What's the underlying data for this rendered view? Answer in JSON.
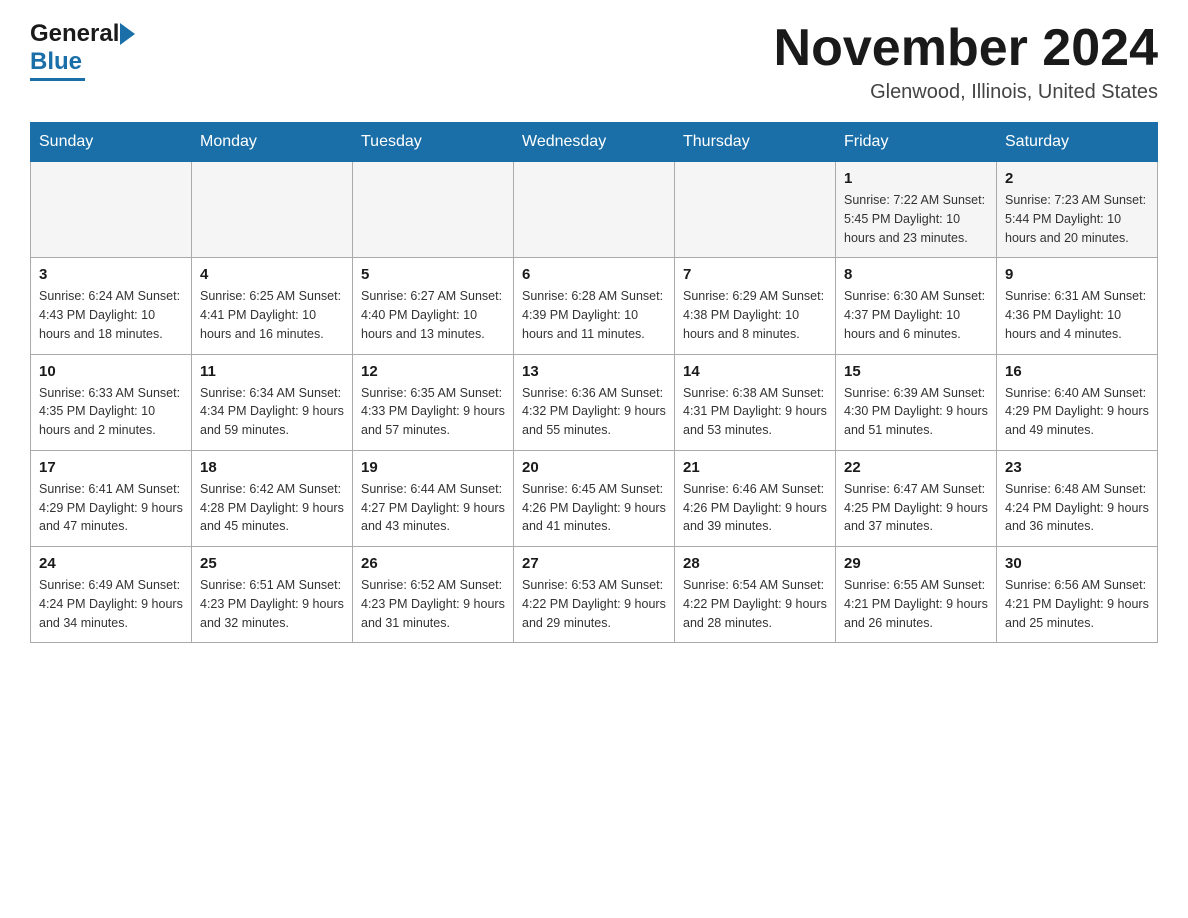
{
  "logo": {
    "general": "General",
    "blue": "Blue"
  },
  "title": "November 2024",
  "location": "Glenwood, Illinois, United States",
  "weekdays": [
    "Sunday",
    "Monday",
    "Tuesday",
    "Wednesday",
    "Thursday",
    "Friday",
    "Saturday"
  ],
  "weeks": [
    [
      {
        "day": "",
        "info": ""
      },
      {
        "day": "",
        "info": ""
      },
      {
        "day": "",
        "info": ""
      },
      {
        "day": "",
        "info": ""
      },
      {
        "day": "",
        "info": ""
      },
      {
        "day": "1",
        "info": "Sunrise: 7:22 AM\nSunset: 5:45 PM\nDaylight: 10 hours and 23 minutes."
      },
      {
        "day": "2",
        "info": "Sunrise: 7:23 AM\nSunset: 5:44 PM\nDaylight: 10 hours and 20 minutes."
      }
    ],
    [
      {
        "day": "3",
        "info": "Sunrise: 6:24 AM\nSunset: 4:43 PM\nDaylight: 10 hours and 18 minutes."
      },
      {
        "day": "4",
        "info": "Sunrise: 6:25 AM\nSunset: 4:41 PM\nDaylight: 10 hours and 16 minutes."
      },
      {
        "day": "5",
        "info": "Sunrise: 6:27 AM\nSunset: 4:40 PM\nDaylight: 10 hours and 13 minutes."
      },
      {
        "day": "6",
        "info": "Sunrise: 6:28 AM\nSunset: 4:39 PM\nDaylight: 10 hours and 11 minutes."
      },
      {
        "day": "7",
        "info": "Sunrise: 6:29 AM\nSunset: 4:38 PM\nDaylight: 10 hours and 8 minutes."
      },
      {
        "day": "8",
        "info": "Sunrise: 6:30 AM\nSunset: 4:37 PM\nDaylight: 10 hours and 6 minutes."
      },
      {
        "day": "9",
        "info": "Sunrise: 6:31 AM\nSunset: 4:36 PM\nDaylight: 10 hours and 4 minutes."
      }
    ],
    [
      {
        "day": "10",
        "info": "Sunrise: 6:33 AM\nSunset: 4:35 PM\nDaylight: 10 hours and 2 minutes."
      },
      {
        "day": "11",
        "info": "Sunrise: 6:34 AM\nSunset: 4:34 PM\nDaylight: 9 hours and 59 minutes."
      },
      {
        "day": "12",
        "info": "Sunrise: 6:35 AM\nSunset: 4:33 PM\nDaylight: 9 hours and 57 minutes."
      },
      {
        "day": "13",
        "info": "Sunrise: 6:36 AM\nSunset: 4:32 PM\nDaylight: 9 hours and 55 minutes."
      },
      {
        "day": "14",
        "info": "Sunrise: 6:38 AM\nSunset: 4:31 PM\nDaylight: 9 hours and 53 minutes."
      },
      {
        "day": "15",
        "info": "Sunrise: 6:39 AM\nSunset: 4:30 PM\nDaylight: 9 hours and 51 minutes."
      },
      {
        "day": "16",
        "info": "Sunrise: 6:40 AM\nSunset: 4:29 PM\nDaylight: 9 hours and 49 minutes."
      }
    ],
    [
      {
        "day": "17",
        "info": "Sunrise: 6:41 AM\nSunset: 4:29 PM\nDaylight: 9 hours and 47 minutes."
      },
      {
        "day": "18",
        "info": "Sunrise: 6:42 AM\nSunset: 4:28 PM\nDaylight: 9 hours and 45 minutes."
      },
      {
        "day": "19",
        "info": "Sunrise: 6:44 AM\nSunset: 4:27 PM\nDaylight: 9 hours and 43 minutes."
      },
      {
        "day": "20",
        "info": "Sunrise: 6:45 AM\nSunset: 4:26 PM\nDaylight: 9 hours and 41 minutes."
      },
      {
        "day": "21",
        "info": "Sunrise: 6:46 AM\nSunset: 4:26 PM\nDaylight: 9 hours and 39 minutes."
      },
      {
        "day": "22",
        "info": "Sunrise: 6:47 AM\nSunset: 4:25 PM\nDaylight: 9 hours and 37 minutes."
      },
      {
        "day": "23",
        "info": "Sunrise: 6:48 AM\nSunset: 4:24 PM\nDaylight: 9 hours and 36 minutes."
      }
    ],
    [
      {
        "day": "24",
        "info": "Sunrise: 6:49 AM\nSunset: 4:24 PM\nDaylight: 9 hours and 34 minutes."
      },
      {
        "day": "25",
        "info": "Sunrise: 6:51 AM\nSunset: 4:23 PM\nDaylight: 9 hours and 32 minutes."
      },
      {
        "day": "26",
        "info": "Sunrise: 6:52 AM\nSunset: 4:23 PM\nDaylight: 9 hours and 31 minutes."
      },
      {
        "day": "27",
        "info": "Sunrise: 6:53 AM\nSunset: 4:22 PM\nDaylight: 9 hours and 29 minutes."
      },
      {
        "day": "28",
        "info": "Sunrise: 6:54 AM\nSunset: 4:22 PM\nDaylight: 9 hours and 28 minutes."
      },
      {
        "day": "29",
        "info": "Sunrise: 6:55 AM\nSunset: 4:21 PM\nDaylight: 9 hours and 26 minutes."
      },
      {
        "day": "30",
        "info": "Sunrise: 6:56 AM\nSunset: 4:21 PM\nDaylight: 9 hours and 25 minutes."
      }
    ]
  ]
}
